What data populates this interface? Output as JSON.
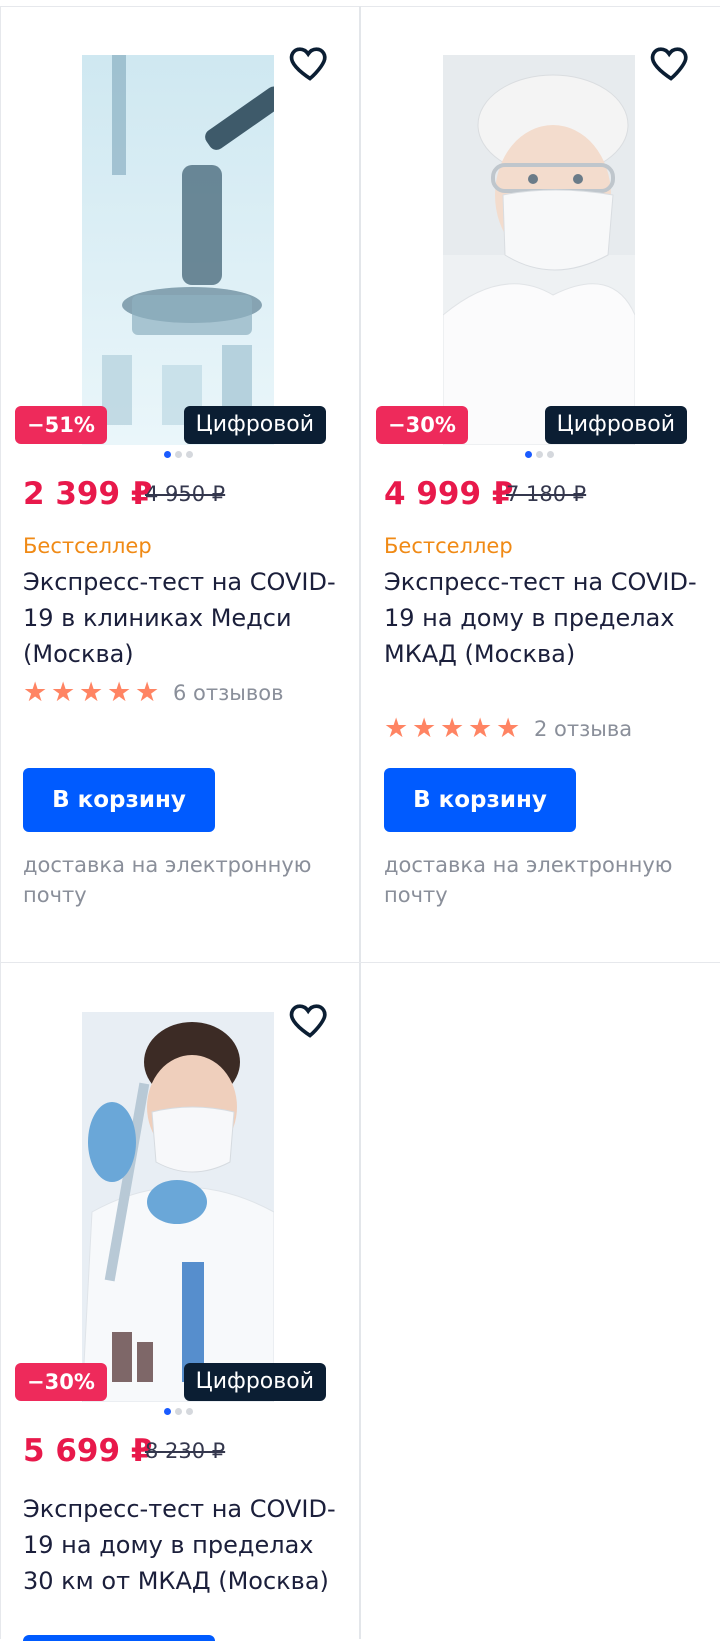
{
  "products": [
    {
      "discount": "−51%",
      "type_label": "Цифровой",
      "price": "2 399 ₽",
      "old_price": "4 950 ₽",
      "badge": "Бестселлер",
      "title": "Экспресс-тест на COVID-19 в клиниках Медси (Москва)",
      "rating": 5,
      "reviews": "6 отзывов",
      "cart_label": "В корзину",
      "delivery": "доставка на электронную почту",
      "colors": {
        "image_bg": "#d9eef5"
      }
    },
    {
      "discount": "−30%",
      "type_label": "Цифровой",
      "price": "4 999 ₽",
      "old_price": "7 180 ₽",
      "badge": "Бестселлер",
      "title": "Экспресс-тест на COVID-19 на дому в пределах МКАД (Москва)",
      "rating": 5,
      "reviews": "2 отзыва",
      "cart_label": "В корзину",
      "delivery": "доставка на электронную почту",
      "colors": {
        "image_bg": "#eef1f3"
      }
    },
    {
      "discount": "−30%",
      "type_label": "Цифровой",
      "price": "5 699 ₽",
      "old_price": "8 230 ₽",
      "title": "Экспресс-тест на COVID-19 на дому в пределах 30 км от МКАД (Москва)",
      "colors": {
        "image_bg": "#e8eef4"
      }
    }
  ],
  "icons": {
    "favorite": "heart-outline-icon",
    "star": "star-icon"
  },
  "accent_colors": {
    "price": "#e8194b",
    "discount": "#ee2a5b",
    "button": "#005bff",
    "bestseller": "#f08a15",
    "stars": "#ff8463"
  }
}
